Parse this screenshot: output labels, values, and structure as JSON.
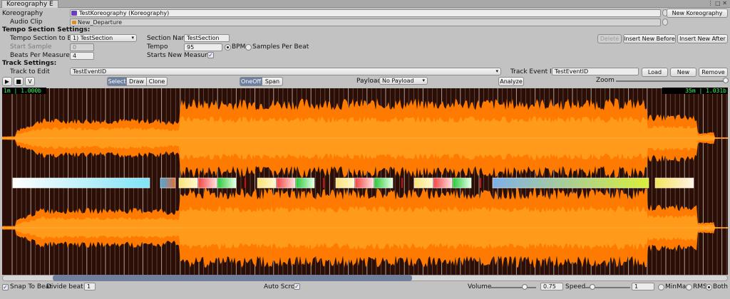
{
  "window": {
    "tab_title": "Koreography E",
    "tab_icons": "⋮ □ ✕"
  },
  "koreography": {
    "label": "Koreography",
    "value": "TestKoreography (Koreography)",
    "new_button": "New Koreography"
  },
  "audio_clip": {
    "label": "Audio Clip",
    "value": "New_Departure"
  },
  "tempo": {
    "header": "Tempo Section Settings:",
    "section_to_edit_label": "Tempo Section to Edit",
    "section_to_edit_value": "1) TestSection",
    "start_sample_label": "Start Sample",
    "start_sample_value": "0",
    "beats_per_measure_label": "Beats Per Measure",
    "beats_per_measure_value": "4",
    "section_name_label": "Section Name",
    "section_name_value": "TestSection",
    "tempo_label": "Tempo",
    "tempo_value": "95",
    "bpm_label": "BPM",
    "samples_per_beat_label": "Samples Per Beat",
    "starts_new_measure_label": "Starts New Measure",
    "starts_new_measure_checked": true,
    "delete_button": "Delete",
    "insert_before_button": "Insert New Before",
    "insert_after_button": "Insert New After"
  },
  "track": {
    "header": "Track Settings:",
    "track_to_edit_label": "Track to Edit",
    "track_to_edit_value": "TestEventID",
    "event_id_label": "Track Event ID",
    "event_id_value": "TestEventID",
    "load_button": "Load",
    "new_button": "New",
    "remove_button": "Remove"
  },
  "toolbar": {
    "play_icon": "▶",
    "stop_icon": "■",
    "v_button": "V",
    "select_label": "Select",
    "draw_label": "Draw",
    "clone_label": "Clone",
    "oneoff_label": "OneOff",
    "span_label": "Span",
    "payload_label": "Payload",
    "payload_value": "No Payload",
    "analyze_button": "Analyze",
    "zoom_label": "Zoom"
  },
  "waveform": {
    "time_start": "1m | 1.000b",
    "time_end": "35m | 1.031b",
    "colors": {
      "background": "#2b0e05",
      "wave_outer": "#ff7a00",
      "wave_inner": "#ff9a1a",
      "beat_line": "#d9d0c8"
    }
  },
  "footer": {
    "snap_to_beat_label": "Snap To Beat",
    "snap_checked": true,
    "divide_beat_label": "Divide beat by",
    "divide_beat_value": "1",
    "auto_scroll_label": "Auto Scroll",
    "auto_scroll_checked": true,
    "volume_label": "Volume",
    "volume_value": "0.75",
    "speed_label": "Speed",
    "speed_value": "1",
    "minmax_label": "MinMax",
    "rms_label": "RMS",
    "both_label": "Both"
  }
}
